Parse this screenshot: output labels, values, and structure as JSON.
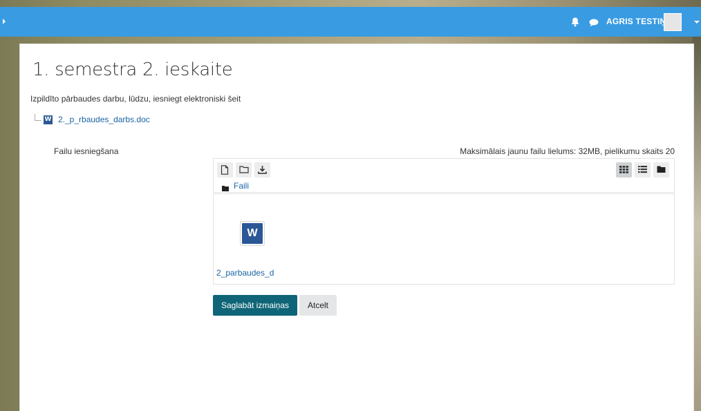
{
  "header": {
    "user_name": "AGRIS TESTIŅŠ",
    "icons": [
      "bell-icon",
      "chat-icon",
      "user-avatar"
    ],
    "bar_color": "#399be2"
  },
  "page": {
    "title": "1. semestra 2. ieskaite",
    "intro": "Izpildīto pārbaudes darbu, lūdzu, iesniegt elektroniski šeit",
    "attachment": "2._p_rbaudes_darbs.doc"
  },
  "form": {
    "field_label": "Failu iesniegšana",
    "limits": "Maksimālais jaunu failu lielums: 32MB, pielikumu skaits 20",
    "breadcrumb": "Faili",
    "files": [
      {
        "name": "2_parbaudes_d",
        "icon": "word-file-icon"
      }
    ],
    "toolbar_left": [
      "add-file-icon",
      "create-folder-icon",
      "download-icon"
    ],
    "toolbar_right": [
      "grid-view-icon",
      "list-view-icon",
      "folder-tree-view-icon"
    ],
    "save_label": "Saglabāt izmaiņas",
    "cancel_label": "Atcelt"
  },
  "colors": {
    "primary_button": "#0f6577",
    "link": "#1a64a5",
    "word": "#2b5797"
  }
}
